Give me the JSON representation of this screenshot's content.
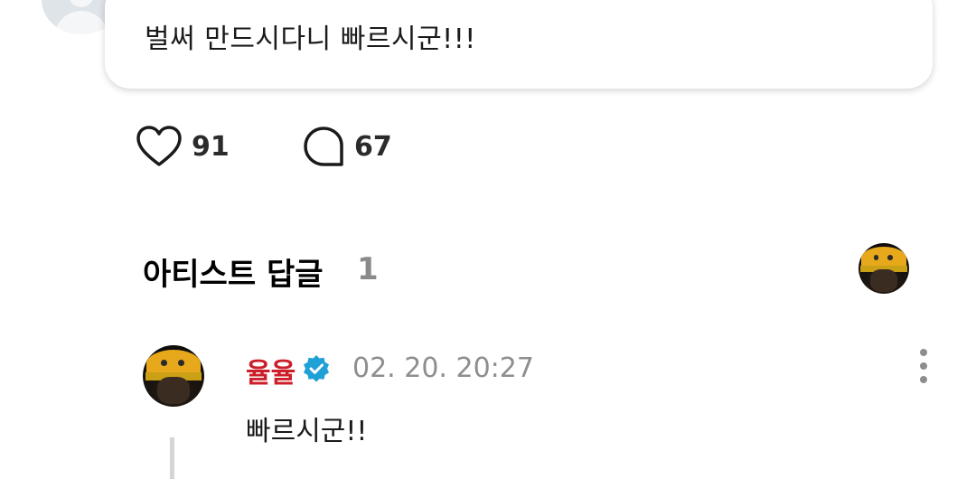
{
  "previous_comment": {
    "text": "벌써 만드시다니 빠르시군!!!",
    "avatar_icon": "default-avatar-icon"
  },
  "actions": {
    "like": {
      "icon": "heart-icon",
      "count": "91"
    },
    "comment": {
      "icon": "speech-bubble-icon",
      "count": "67"
    }
  },
  "artist_replies": {
    "title": "아티스트 답글",
    "count": "1"
  },
  "reply": {
    "author": "율율",
    "author_color": "#cc1f2a",
    "verified_color": "#1fa0d6",
    "time": "02. 20. 20:27",
    "text": "빠르시군!!"
  }
}
